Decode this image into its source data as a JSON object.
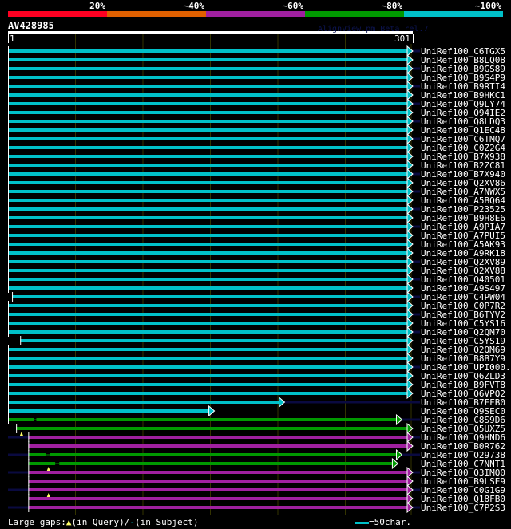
{
  "legend_scale": {
    "labels": [
      "20%",
      "~40%",
      "~60%",
      "~80%",
      "~100%"
    ],
    "colors": [
      "#ff0022",
      "#e06000",
      "#a020a0",
      "#009900",
      "#00c0c8"
    ]
  },
  "query": {
    "name": "AV428985",
    "start_label": "1",
    "end_label": "301",
    "length": 301
  },
  "watermark": "AlignView.pm Beta rel.7",
  "grid_every_chars": 50,
  "hits": [
    {
      "name": "UniRef100_C6TGX5",
      "color": 4,
      "start": 1,
      "end": 301,
      "tail": true
    },
    {
      "name": "UniRef100_B8LQ08",
      "color": 4,
      "start": 1,
      "end": 301
    },
    {
      "name": "UniRef100_B9GS89",
      "color": 4,
      "start": 1,
      "end": 301,
      "tail": true
    },
    {
      "name": "UniRef100_B9S4P9",
      "color": 4,
      "start": 1,
      "end": 301
    },
    {
      "name": "UniRef100_B9RTI4",
      "color": 4,
      "start": 1,
      "end": 301,
      "tail": true
    },
    {
      "name": "UniRef100_B9HKC1",
      "color": 4,
      "start": 1,
      "end": 301
    },
    {
      "name": "UniRef100_Q9LY74",
      "color": 4,
      "start": 1,
      "end": 301,
      "tail": true
    },
    {
      "name": "UniRef100_Q94IE2",
      "color": 4,
      "start": 1,
      "end": 301
    },
    {
      "name": "UniRef100_Q8LDQ3",
      "color": 4,
      "start": 1,
      "end": 301,
      "tail": true
    },
    {
      "name": "UniRef100_Q1EC48",
      "color": 4,
      "start": 1,
      "end": 301
    },
    {
      "name": "UniRef100_C6TMQ7",
      "color": 4,
      "start": 1,
      "end": 301,
      "tail": true
    },
    {
      "name": "UniRef100_C0Z2G4",
      "color": 4,
      "start": 1,
      "end": 301
    },
    {
      "name": "UniRef100_B7X938",
      "color": 4,
      "start": 1,
      "end": 301
    },
    {
      "name": "UniRef100_B2ZC81",
      "color": 4,
      "start": 1,
      "end": 301
    },
    {
      "name": "UniRef100_B7X940",
      "color": 4,
      "start": 1,
      "end": 301,
      "tail": true
    },
    {
      "name": "UniRef100_Q2XV86",
      "color": 4,
      "start": 1,
      "end": 301
    },
    {
      "name": "UniRef100_A7NWX5",
      "color": 4,
      "start": 1,
      "end": 301,
      "tail": true
    },
    {
      "name": "UniRef100_A5BQ64",
      "color": 4,
      "start": 1,
      "end": 301
    },
    {
      "name": "UniRef100_P23525",
      "color": 4,
      "start": 1,
      "end": 301,
      "tail": true
    },
    {
      "name": "UniRef100_B9H8E6",
      "color": 4,
      "start": 1,
      "end": 301
    },
    {
      "name": "UniRef100_A9PIA7",
      "color": 4,
      "start": 1,
      "end": 301,
      "tail": true
    },
    {
      "name": "UniRef100_A7PUI5",
      "color": 4,
      "start": 1,
      "end": 301
    },
    {
      "name": "UniRef100_A5AK93",
      "color": 4,
      "start": 1,
      "end": 301
    },
    {
      "name": "UniRef100_A9RK18",
      "color": 4,
      "start": 1,
      "end": 301
    },
    {
      "name": "UniRef100_Q2XV89",
      "color": 4,
      "start": 1,
      "end": 301,
      "tail": true
    },
    {
      "name": "UniRef100_Q2XV88",
      "color": 4,
      "start": 1,
      "end": 301
    },
    {
      "name": "UniRef100_Q40501",
      "color": 4,
      "start": 1,
      "end": 301,
      "tail": true
    },
    {
      "name": "UniRef100_A9S497",
      "color": 4,
      "start": 1,
      "end": 301
    },
    {
      "name": "UniRef100_C4PW04",
      "color": 4,
      "start": 4,
      "end": 301,
      "tail": true
    },
    {
      "name": "UniRef100_C0P7R2",
      "color": 4,
      "start": 1,
      "end": 301
    },
    {
      "name": "UniRef100_B6TYV2",
      "color": 4,
      "start": 1,
      "end": 301,
      "tail": true
    },
    {
      "name": "UniRef100_C5YS16",
      "color": 4,
      "start": 1,
      "end": 301
    },
    {
      "name": "UniRef100_Q2QM70",
      "color": 4,
      "start": 1,
      "end": 301,
      "tail": true
    },
    {
      "name": "UniRef100_C5YS19",
      "color": 4,
      "start": 10,
      "end": 301
    },
    {
      "name": "UniRef100_Q2QM69",
      "color": 4,
      "start": 1,
      "end": 301
    },
    {
      "name": "UniRef100_B8B7Y9",
      "color": 4,
      "start": 1,
      "end": 301
    },
    {
      "name": "UniRef100_UPI000..",
      "color": 4,
      "start": 1,
      "end": 301,
      "tail": true
    },
    {
      "name": "UniRef100_Q6ZLD3",
      "color": 4,
      "start": 1,
      "end": 301
    },
    {
      "name": "UniRef100_B9FVT8",
      "color": 4,
      "start": 1,
      "end": 301
    },
    {
      "name": "UniRef100_Q6VPQ2",
      "color": 4,
      "start": 1,
      "end": 301
    },
    {
      "name": "UniRef100_B7FFB0",
      "color": 4,
      "start": 1,
      "end": 206,
      "tail": true
    },
    {
      "name": "UniRef100_Q9SEC0",
      "color": 4,
      "start": 1,
      "end": 154
    },
    {
      "name": "UniRef100_C8S9D6",
      "color": 3,
      "start": 1,
      "end": 293,
      "tail": true,
      "subject_gaps": [
        [
          20,
          22
        ]
      ]
    },
    {
      "name": "UniRef100_Q5UXZ5",
      "color": 3,
      "start": 7,
      "end": 301,
      "query_gaps": [
        11
      ]
    },
    {
      "name": "UniRef100_Q9HND6",
      "color": 2,
      "start": 16,
      "end": 301,
      "tail": true,
      "lead": true
    },
    {
      "name": "UniRef100_B0R762",
      "color": 2,
      "start": 16,
      "end": 301
    },
    {
      "name": "UniRef100_O29738",
      "color": 3,
      "start": 16,
      "end": 293,
      "tail": true,
      "lead": true,
      "subject_gaps": [
        [
          29,
          32
        ]
      ]
    },
    {
      "name": "UniRef100_C7NNT1",
      "color": 3,
      "start": 16,
      "end": 290,
      "subject_gaps": [
        [
          36,
          39
        ]
      ],
      "query_gaps": [
        31
      ]
    },
    {
      "name": "UniRef100_Q3IMQ0",
      "color": 2,
      "start": 16,
      "end": 301,
      "tail": true,
      "lead": true
    },
    {
      "name": "UniRef100_B9LSE9",
      "color": 2,
      "start": 16,
      "end": 301
    },
    {
      "name": "UniRef100_C0G1G9",
      "color": 2,
      "start": 16,
      "end": 301,
      "tail": true,
      "lead": true,
      "query_gaps": [
        31
      ]
    },
    {
      "name": "UniRef100_Q18FB0",
      "color": 2,
      "start": 16,
      "end": 301
    },
    {
      "name": "UniRef100_C7P2S3",
      "color": 2,
      "start": 16,
      "end": 301,
      "tail": true,
      "lead": true
    }
  ],
  "footer": {
    "large_gaps_label": "Large gaps:",
    "in_query": "(in Query)/",
    "in_subject": "(in Subject)",
    "scale_label": "=50char."
  }
}
